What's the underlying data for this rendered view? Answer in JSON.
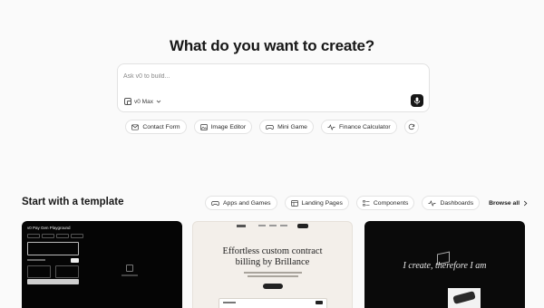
{
  "hero": {
    "title": "What do you want to create?",
    "prompt_placeholder": "Ask v0 to build...",
    "model": "v0 Max"
  },
  "suggestions": [
    {
      "label": "Contact Form",
      "icon": "mail-icon"
    },
    {
      "label": "Image Editor",
      "icon": "image-icon"
    },
    {
      "label": "Mini Game",
      "icon": "gamepad-icon"
    },
    {
      "label": "Finance Calculator",
      "icon": "activity-icon"
    }
  ],
  "templates": {
    "section_title": "Start with a template",
    "tabs": [
      {
        "label": "Apps and Games",
        "icon": "gamepad-icon"
      },
      {
        "label": "Landing Pages",
        "icon": "layout-icon"
      },
      {
        "label": "Components",
        "icon": "list-icon"
      },
      {
        "label": "Dashboards",
        "icon": "activity-icon"
      }
    ],
    "browse_all": "Browse all",
    "cards": [
      {
        "title": "v0 Pay Gen Playground"
      },
      {
        "heading_line1": "Effortless custom contract",
        "heading_line2": "billing by Brillance"
      },
      {
        "text": "I create, therefore I am"
      }
    ]
  },
  "colors": {
    "background": "#fafafa",
    "text": "#171717",
    "border": "#e3e3e3",
    "mic_button": "#171717"
  }
}
